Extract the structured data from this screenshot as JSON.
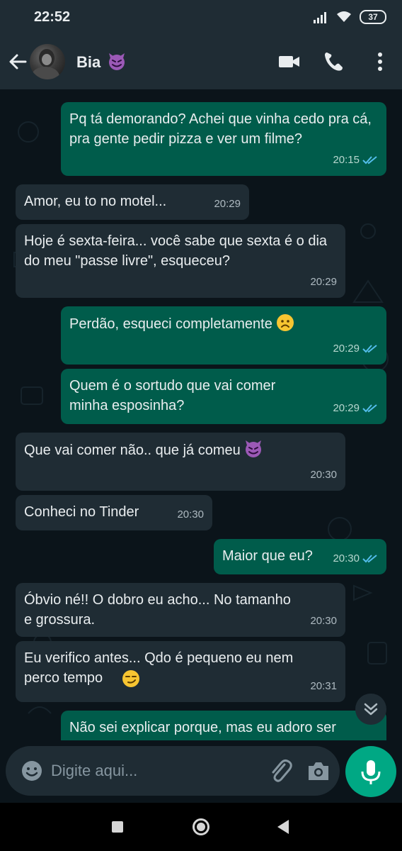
{
  "status_bar": {
    "time": "22:52",
    "battery": "37"
  },
  "header": {
    "contact_name": "Bia"
  },
  "messages": [
    {
      "dir": "out",
      "text": "Pq tá demorando? Achei que vinha cedo pra cá, pra gente pedir pizza e ver um filme?",
      "time": "20:15",
      "read": true
    },
    {
      "dir": "in",
      "text": "Amor, eu to no motel...",
      "time": "20:29"
    },
    {
      "dir": "in",
      "text": "Hoje é sexta-feira... você sabe que sexta é o dia do meu \"passe livre\", esqueceu?",
      "time": "20:29"
    },
    {
      "dir": "out",
      "text": "Perdão, esqueci completamente",
      "emoji": "frowning-face",
      "time": "20:29",
      "read": true
    },
    {
      "dir": "out",
      "text": "Quem é o sortudo que vai comer minha esposinha?",
      "time": "20:29",
      "read": true
    },
    {
      "dir": "in",
      "text": "Que vai comer não.. que já comeu",
      "emoji": "smiling-imp",
      "time": "20:30"
    },
    {
      "dir": "in",
      "text": "Conheci no Tinder",
      "time": "20:30"
    },
    {
      "dir": "out",
      "text": "Maior que eu?",
      "time": "20:30",
      "read": true
    },
    {
      "dir": "in",
      "text": "Óbvio né!! O dobro eu acho... No tamanho e grossura.",
      "time": "20:30"
    },
    {
      "dir": "in",
      "text": "Eu verifico antes... Qdo é pequeno eu nem perco tempo",
      "emoji": "smirking-face",
      "time": "20:31"
    },
    {
      "dir": "out",
      "text": "Não sei explicar porque, mas eu adoro ser"
    }
  ],
  "composer": {
    "placeholder": "Digite aqui..."
  },
  "colors": {
    "background": "#0b141a",
    "bar": "#1f2c34",
    "incoming_bubble": "#1f2c34",
    "outgoing_bubble": "#005c4b",
    "accent": "#00a884",
    "read_ticks": "#53bdeb"
  }
}
